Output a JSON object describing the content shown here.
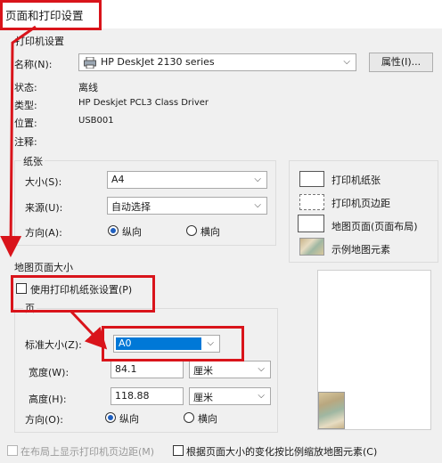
{
  "window": {
    "title": "页面和打印设置"
  },
  "printer": {
    "group_label": "打印机设置",
    "name_label": "名称(N):",
    "name_value": "HP DeskJet 2130 series",
    "properties_button": "属性(I)...",
    "status_label": "状态:",
    "status_value": "离线",
    "type_label": "类型:",
    "type_value": "HP Deskjet PCL3 Class Driver",
    "location_label": "位置:",
    "location_value": "USB001",
    "comment_label": "注释:"
  },
  "paper": {
    "group_label": "纸张",
    "size_label": "大小(S):",
    "size_value": "A4",
    "source_label": "来源(U):",
    "source_value": "自动选择",
    "orientation_label": "方向(A):",
    "portrait": "纵向",
    "landscape": "横向"
  },
  "legend": {
    "printer_paper": "打印机纸张",
    "printer_margin": "打印机页边距",
    "map_page": "地图页面(页面布局)",
    "sample_elements": "示例地图元素"
  },
  "map_page": {
    "group_label": "地图页面大小",
    "use_printer_settings": "使用打印机纸张设置(P)",
    "page_label": "页",
    "standard_size_label": "标准大小(Z):",
    "standard_size_value": "A0",
    "width_label": "宽度(W):",
    "width_value": "84.1",
    "width_unit": "厘米",
    "height_label": "高度(H):",
    "height_value": "118.88",
    "height_unit": "厘米",
    "orientation_label": "方向(O):",
    "portrait": "纵向",
    "landscape": "横向"
  },
  "footer": {
    "show_margins": "在布局上显示打印机页边距(M)",
    "scale_elements": "根据页面大小的变化按比例缩放地图元素(C)"
  },
  "colors": {
    "annotation": "#d9141b",
    "selection": "#0078d7",
    "radio_dot": "#1f5fbf"
  }
}
